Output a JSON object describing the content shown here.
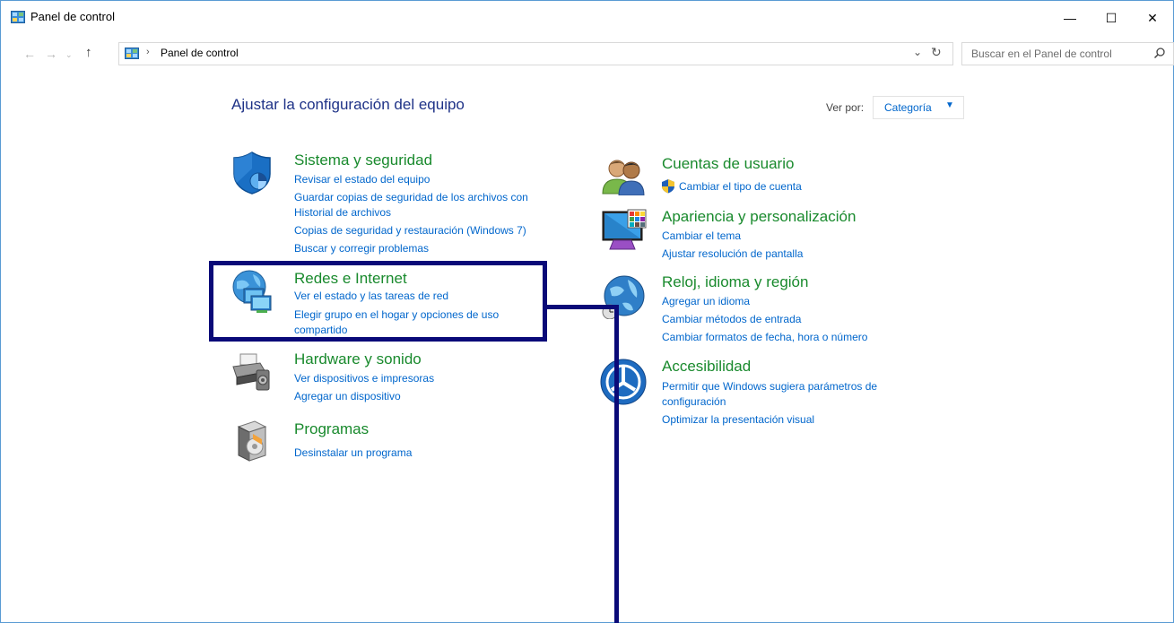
{
  "window": {
    "title": "Panel de control",
    "minimize_glyph": "—",
    "maximize_glyph": "☐",
    "close_glyph": "✕"
  },
  "nav": {
    "back_glyph": "←",
    "forward_glyph": "→",
    "history_glyph": "⌄",
    "up_glyph": "↑",
    "breadcrumb_sep": "›",
    "address": "Panel de control",
    "dropdown_glyph": "⌄",
    "refresh_glyph": "↻",
    "search_placeholder": "Buscar en el Panel de control"
  },
  "main": {
    "title": "Ajustar la configuración del equipo",
    "view_by_label": "Ver por:",
    "view_by_value": "Categoría",
    "view_by_arrow": "▼"
  },
  "categories_left": [
    {
      "title": "Sistema y seguridad",
      "icon": "shield-icon",
      "links": [
        "Revisar el estado del equipo",
        "Guardar copias de seguridad de los archivos con",
        "Historial de archivos",
        "Copias de seguridad y restauración (Windows 7)",
        "Buscar y corregir problemas"
      ]
    },
    {
      "title": "Redes e Internet",
      "icon": "network-icon",
      "links": [
        "Ver el estado y las tareas de red",
        "Elegir grupo en el hogar y opciones de uso",
        "compartido"
      ]
    },
    {
      "title": "Hardware y sonido",
      "icon": "printer-icon",
      "links": [
        "Ver dispositivos e impresoras",
        "Agregar un dispositivo"
      ]
    },
    {
      "title": "Programas",
      "icon": "programs-icon",
      "links": [
        "Desinstalar un programa"
      ]
    }
  ],
  "categories_right": [
    {
      "title": "Cuentas de usuario",
      "icon": "users-icon",
      "links": [
        "Cambiar el tipo de cuenta"
      ]
    },
    {
      "title": "Apariencia y personalización",
      "icon": "monitor-icon",
      "links": [
        "Cambiar el tema",
        "Ajustar resolución de pantalla"
      ]
    },
    {
      "title": "Reloj, idioma y región",
      "icon": "globe-clock-icon",
      "links": [
        "Agregar un idioma",
        "Cambiar métodos de entrada",
        "Cambiar formatos de fecha, hora o número"
      ]
    },
    {
      "title": "Accesibilidad",
      "icon": "accessibility-icon",
      "links": [
        "Permitir que Windows sugiera parámetros de",
        "configuración",
        "Optimizar la presentación visual"
      ]
    }
  ],
  "colors": {
    "category_title": "#198a2d",
    "link": "#0066cc",
    "page_title": "#1e3287",
    "annotation": "#0a0a78"
  }
}
